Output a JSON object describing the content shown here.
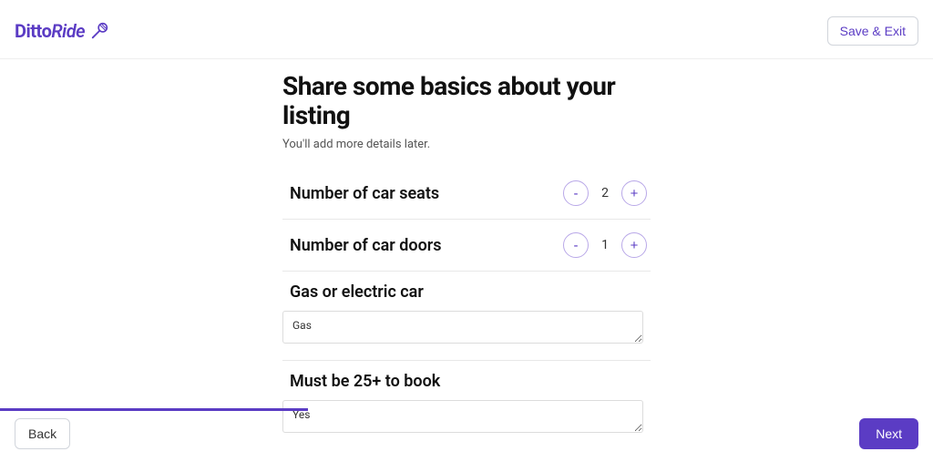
{
  "brand": {
    "name_part1": "Ditto",
    "name_part2": "Ride"
  },
  "header": {
    "save_exit": "Save & Exit"
  },
  "page": {
    "title": "Share some basics about your listing",
    "subtitle": "You'll add more details later."
  },
  "form": {
    "seats": {
      "label": "Number of car seats",
      "value": "2"
    },
    "doors": {
      "label": "Number of car doors",
      "value": "1"
    },
    "fuel": {
      "label": "Gas or electric car",
      "value": "Gas"
    },
    "age": {
      "label": "Must be 25+ to book",
      "value": "Yes"
    }
  },
  "footer": {
    "back": "Back",
    "next": "Next"
  },
  "progress": {
    "percent": 33
  },
  "stepper": {
    "minus": "-",
    "plus": "+"
  }
}
